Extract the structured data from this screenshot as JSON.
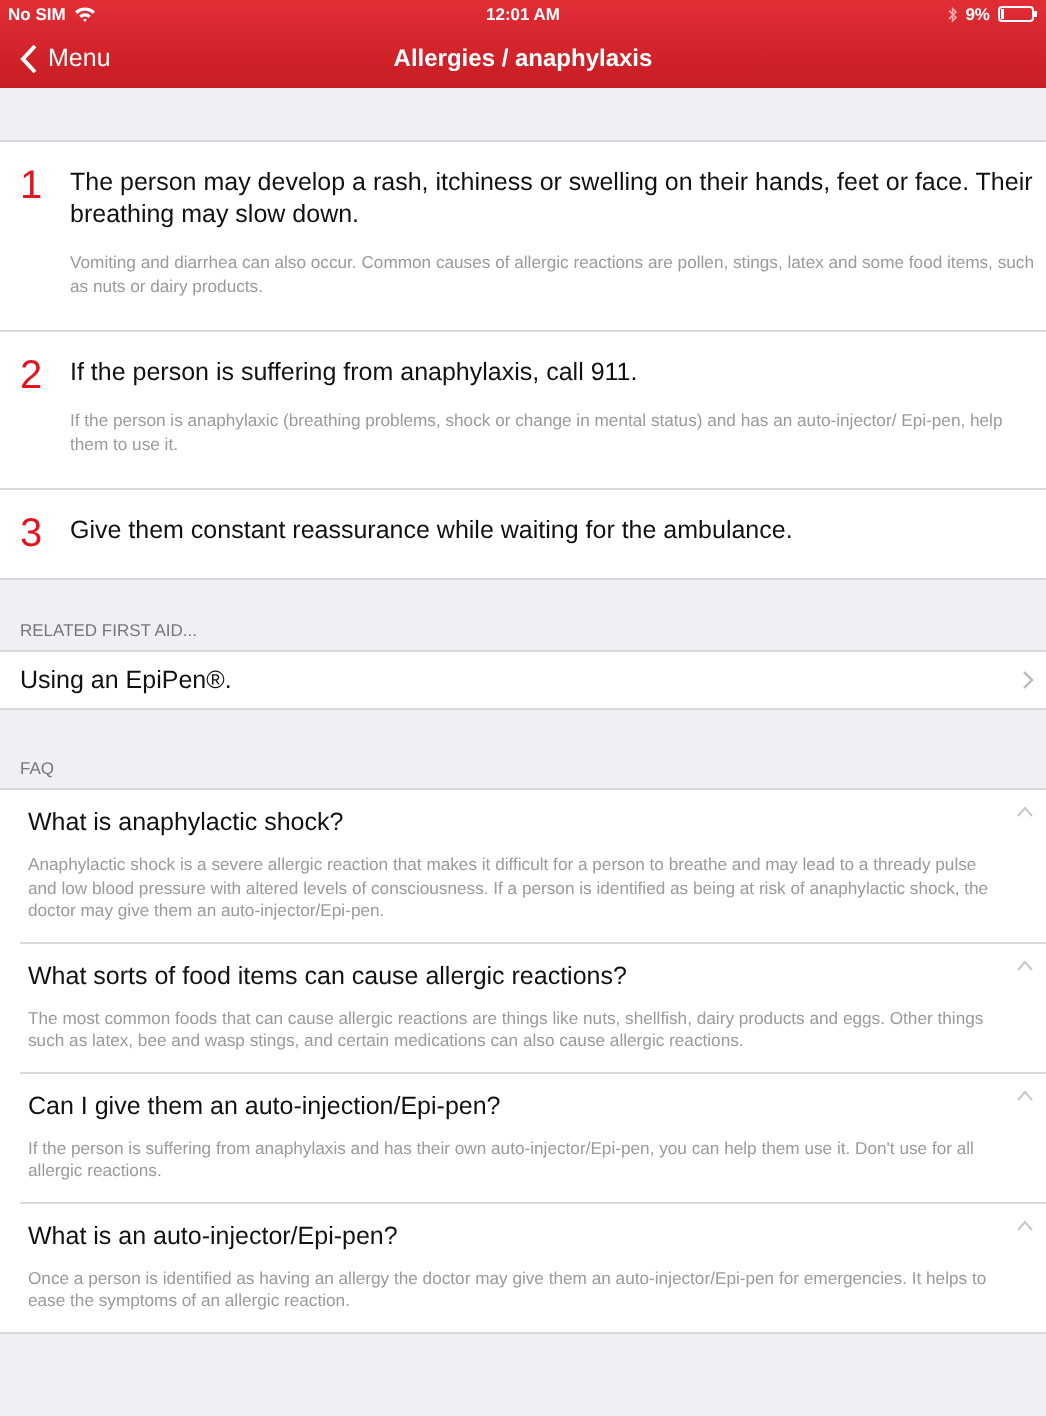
{
  "status_bar": {
    "carrier": "No SIM",
    "time": "12:01 AM",
    "battery": "9%"
  },
  "nav": {
    "back": "Menu",
    "title": "Allergies / anaphylaxis"
  },
  "steps": [
    {
      "number": "1",
      "text": "The person may develop a rash, itchiness or swelling on their hands, feet or face. Their breathing may slow down.",
      "detail": "Vomiting and diarrhea can also occur. Common causes of allergic reactions are pollen, stings, latex and some food items, such as nuts or dairy products."
    },
    {
      "number": "2",
      "text": "If the person is suffering from anaphylaxis, call 911.",
      "detail": "If the person is anaphylaxic (breathing problems, shock or change in mental status) and has an auto-injector/ Epi-pen, help them to use it."
    },
    {
      "number": "3",
      "text": "Give them constant reassurance while waiting for the ambulance."
    }
  ],
  "related": {
    "heading": "RELATED FIRST AID...",
    "items": [
      "Using an EpiPen®."
    ]
  },
  "faq": {
    "heading": "FAQ",
    "items": [
      {
        "question": "What is anaphylactic shock?",
        "expanded": true,
        "answer": "Anaphylactic shock is a severe allergic reaction that makes it difficult for a person to breathe and may lead to a thready pulse and low blood pressure with altered levels of consciousness. If a person is identified as being at risk of anaphylactic shock, the doctor may give them an auto-injector/Epi-pen."
      },
      {
        "question": "What sorts of food items can cause allergic reactions?",
        "expanded": true,
        "answer": "The most common foods that can cause allergic reactions are things like nuts, shellfish, dairy products and eggs. Other things such as latex, bee and wasp stings, and certain medications can also cause allergic reactions."
      },
      {
        "question": "Can I give them an auto-injection/Epi-pen?",
        "expanded": true,
        "answer": "If the person is suffering from anaphylaxis and has their own auto-injector/Epi-pen, you can help them use it. Don't use for all allergic reactions."
      },
      {
        "question": "What is an auto-injector/Epi-pen?",
        "expanded": true,
        "answer": "Once a person is identified as having an allergy the doctor may give them an auto-injector/Epi-pen for emergencies. It helps to ease the symptoms of an allergic reaction."
      }
    ]
  }
}
